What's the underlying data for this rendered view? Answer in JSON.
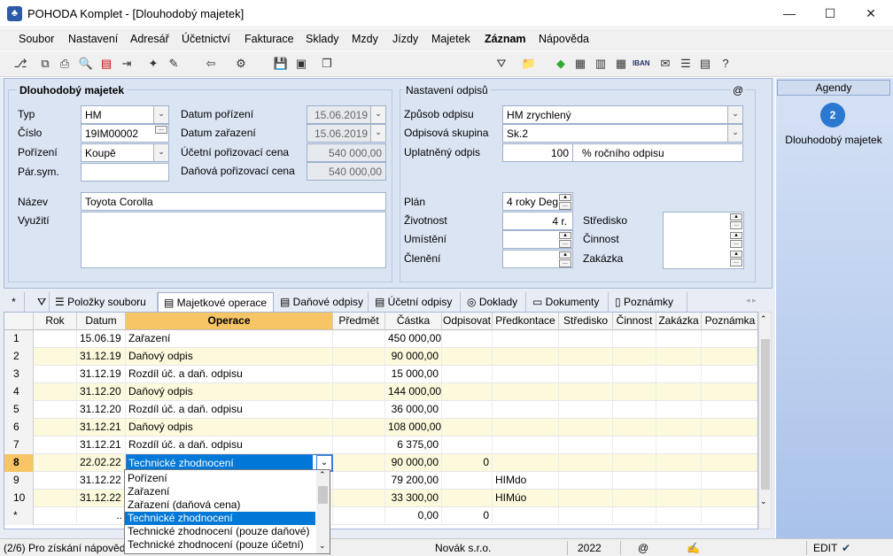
{
  "window": {
    "title": "POHODA Komplet - [Dlouhodobý majetek]"
  },
  "menu": [
    "Soubor",
    "Nastavení",
    "Adresář",
    "Účetnictví",
    "Fakturace",
    "Sklady",
    "Mzdy",
    "Jízdy",
    "Majetek",
    "Záznam",
    "Nápověda"
  ],
  "form": {
    "section_title": "Dlouhodobý majetek",
    "typ_label": "Typ",
    "typ": "HM",
    "cislo_label": "Číslo",
    "cislo": "19IM00002",
    "porizeni_label": "Pořízení",
    "porizeni": "Koupě",
    "parsym_label": "Pár.sym.",
    "datum_porizeni_label": "Datum pořízení",
    "datum_porizeni": "15.06.2019",
    "datum_zarazeni_label": "Datum zařazení",
    "datum_zarazeni": "15.06.2019",
    "ucetni_cena_label": "Účetní pořizovací cena",
    "ucetni_cena": "540 000,00",
    "danova_cena_label": "Daňová pořizovací cena",
    "danova_cena": "540 000,00",
    "nazev_label": "Název",
    "nazev": "Toyota Corolla",
    "vyuziti_label": "Využití"
  },
  "odpisy": {
    "section_title": "Nastavení odpisů",
    "at": "@",
    "zpusob_label": "Způsob odpisu",
    "zpusob": "HM zrychlený",
    "skupina_label": "Odpisová skupina",
    "skupina": "Sk.2",
    "uplatneny_label": "Uplatněný odpis",
    "uplatneny": "100",
    "uplatneny_unit": "% ročního odpisu",
    "plan_label": "Plán",
    "plan": "4 roky Deg",
    "zivotnost_label": "Životnost",
    "zivotnost": "4 r.",
    "umisteni_label": "Umístění",
    "cleneni_label": "Členění",
    "stredisko_label": "Středisko",
    "cinnost_label": "Činnost",
    "zakazka_label": "Zakázka"
  },
  "tabs": [
    "Položky souboru",
    "Majetkové operace",
    "Daňové odpisy",
    "Účetní odpisy",
    "Doklady",
    "Dokumenty",
    "Poznámky"
  ],
  "tab_star": "*",
  "grid": {
    "headers": [
      "Rok",
      "Datum",
      "Operace",
      "Předmět",
      "Částka",
      "Odpisovat",
      "Předkontace",
      "Středisko",
      "Činnost",
      "Zakázka",
      "Poznámka"
    ],
    "rows": [
      {
        "n": "1",
        "datum": "15.06.19",
        "operace": "Zařazení",
        "castka": "450 000,00",
        "odp": "",
        "pk": ""
      },
      {
        "n": "2",
        "datum": "31.12.19",
        "operace": "Daňový odpis",
        "castka": "90 000,00",
        "odp": "",
        "pk": ""
      },
      {
        "n": "3",
        "datum": "31.12.19",
        "operace": "Rozdíl úč. a daň. odpisu",
        "castka": "15 000,00",
        "odp": "",
        "pk": ""
      },
      {
        "n": "4",
        "datum": "31.12.20",
        "operace": "Daňový odpis",
        "castka": "144 000,00",
        "odp": "",
        "pk": ""
      },
      {
        "n": "5",
        "datum": "31.12.20",
        "operace": "Rozdíl úč. a daň. odpisu",
        "castka": "36 000,00",
        "odp": "",
        "pk": ""
      },
      {
        "n": "6",
        "datum": "31.12.21",
        "operace": "Daňový odpis",
        "castka": "108 000,00",
        "odp": "",
        "pk": ""
      },
      {
        "n": "7",
        "datum": "31.12.21",
        "operace": "Rozdíl úč. a daň. odpisu",
        "castka": "6 375,00",
        "odp": "",
        "pk": ""
      },
      {
        "n": "8",
        "datum": "22.02.22",
        "operace": "Technické zhodnocení",
        "castka": "90 000,00",
        "odp": "0",
        "pk": ""
      },
      {
        "n": "9",
        "datum": "31.12.22",
        "operace": "",
        "castka": "79 200,00",
        "odp": "",
        "pk": "HIMdo"
      },
      {
        "n": "10",
        "datum": "31.12.22",
        "operace": "",
        "castka": "33 300,00",
        "odp": "",
        "pk": "HIMúo"
      },
      {
        "n": "*",
        "datum": "..",
        "operace": "",
        "castka": "0,00",
        "odp": "0",
        "pk": ""
      }
    ]
  },
  "dropdown": [
    "Pořízení",
    "Zařazení",
    "Zařazení (daňová cena)",
    "Technické zhodnocení",
    "Technické zhodnocení (pouze daňové)",
    "Technické zhodnocení (pouze účetní)"
  ],
  "agendy": {
    "title": "Agendy",
    "item": "Dlouhodobý majetek"
  },
  "status": {
    "help": "(2/6) Pro získání nápovědy",
    "firm": "Novák s.r.o.",
    "year": "2022",
    "at": "@",
    "mode": "EDIT"
  }
}
